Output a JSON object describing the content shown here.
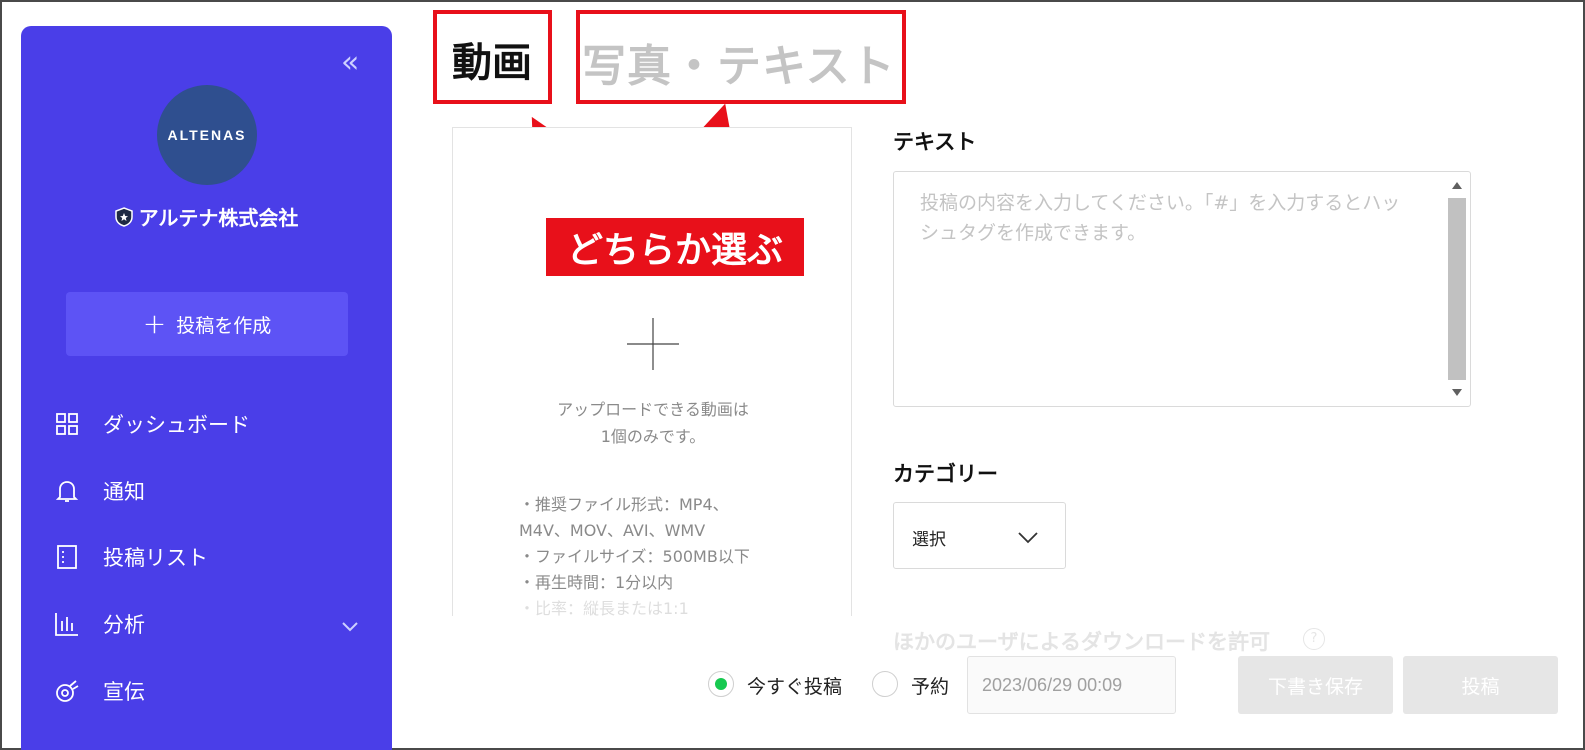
{
  "sidebar": {
    "collapse_glyph": "«",
    "logo_text": "ALTENAS",
    "company_name": "アルテナ株式会社",
    "create_button": "投稿を作成",
    "items": [
      {
        "label": "ダッシュボード",
        "icon": "dashboard-grid-icon"
      },
      {
        "label": "通知",
        "icon": "bell-icon"
      },
      {
        "label": "投稿リスト",
        "icon": "post-list-icon"
      },
      {
        "label": "分析",
        "icon": "bar-chart-icon",
        "expandable": true
      },
      {
        "label": "宣伝",
        "icon": "promotion-icon"
      }
    ],
    "color": "#4a3ee8"
  },
  "tabs": {
    "video": "動画",
    "photo_text": "写真・テキスト"
  },
  "annotation": {
    "callout": "どちらか選ぶ",
    "color": "#e8101a"
  },
  "upload": {
    "title": "アップロードできる動画は1個のみです。",
    "requirements": [
      "・推奨ファイル形式：MP4、M4V、MOV、AVI、WMV",
      "・ファイルサイズ：500MB以下",
      "・再生時間：1分以内",
      "・比率：縦長または1:1"
    ]
  },
  "form": {
    "text_label": "テキスト",
    "text_placeholder": "投稿の内容を入力してください。「#」を入力するとハッシュタグを作成できます。",
    "category_label": "カテゴリー",
    "category_value": "選択",
    "allow_download_label": "ほかのユーザによるダウンロードを許可",
    "help_glyph": "?"
  },
  "footer": {
    "post_now": "今すぐ投稿",
    "schedule": "予約",
    "datetime": "2023/06/29 00:09",
    "save_draft": "下書き保存",
    "post": "投稿",
    "accent": "#17c950"
  }
}
